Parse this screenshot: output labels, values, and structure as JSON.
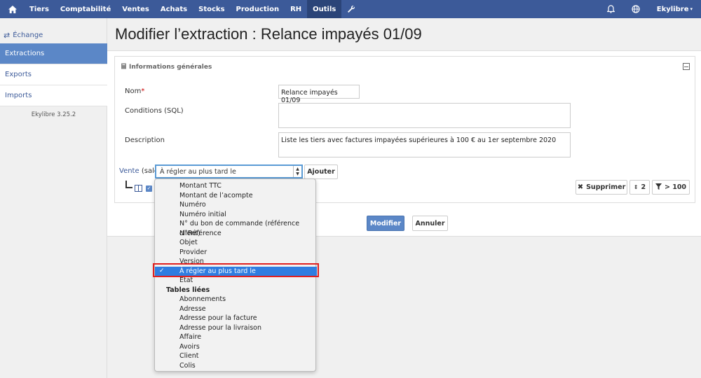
{
  "nav": {
    "items": [
      "Tiers",
      "Comptabilité",
      "Ventes",
      "Achats",
      "Stocks",
      "Production",
      "RH",
      "Outils"
    ],
    "active": "Outils",
    "user": "Ekylibre"
  },
  "sidebar": {
    "heading": "Échange",
    "items": [
      "Extractions",
      "Exports",
      "Imports"
    ],
    "active": "Extractions",
    "version": "Ekylibre 3.25.2"
  },
  "page": {
    "title": "Modifier l’extraction : Relance impayés 01/09"
  },
  "form": {
    "section_title": "Informations générales",
    "name_label": "Nom",
    "name_value": "Relance impayés 01/09",
    "conditions_label": "Conditions (SQL)",
    "conditions_value": "",
    "description_label": "Description",
    "description_value": "Liste les tiers avec factures impayées supérieures à 100 € au 1er septembre 2020",
    "vente_link": "Vente",
    "vente_suffix": "(sale)",
    "select_value": "À régler au plus tard le",
    "add_button": "Ajouter",
    "delete_button": "Supprimer",
    "sort_button": "2",
    "filter_button": "> 100",
    "submit_button": "Modifier",
    "cancel_button": "Annuler"
  },
  "dropdown": {
    "items": [
      {
        "label": "Montant TTC",
        "type": "option"
      },
      {
        "label": "Montant de l’acompte",
        "type": "option"
      },
      {
        "label": "Numéro",
        "type": "option"
      },
      {
        "label": "Numéro initial",
        "type": "option"
      },
      {
        "label": "N° du bon de commande (référence client)",
        "type": "option"
      },
      {
        "label": "N°Référence",
        "type": "option"
      },
      {
        "label": "Objet",
        "type": "option"
      },
      {
        "label": "Provider",
        "type": "option"
      },
      {
        "label": "Version",
        "type": "option"
      },
      {
        "label": "À régler au plus tard le",
        "type": "selected"
      },
      {
        "label": "État",
        "type": "option"
      },
      {
        "label": "Tables liées",
        "type": "group"
      },
      {
        "label": "Abonnements",
        "type": "option"
      },
      {
        "label": "Adresse",
        "type": "option"
      },
      {
        "label": "Adresse pour la facture",
        "type": "option"
      },
      {
        "label": "Adresse pour la livraison",
        "type": "option"
      },
      {
        "label": "Affaire",
        "type": "option"
      },
      {
        "label": "Avoirs",
        "type": "option"
      },
      {
        "label": "Client",
        "type": "option"
      },
      {
        "label": "Colis",
        "type": "option"
      }
    ]
  },
  "colors": {
    "nav_bg": "#3c5a99",
    "accent": "#5b87c7",
    "selection": "#2f7de1",
    "highlight": "#e02020"
  }
}
